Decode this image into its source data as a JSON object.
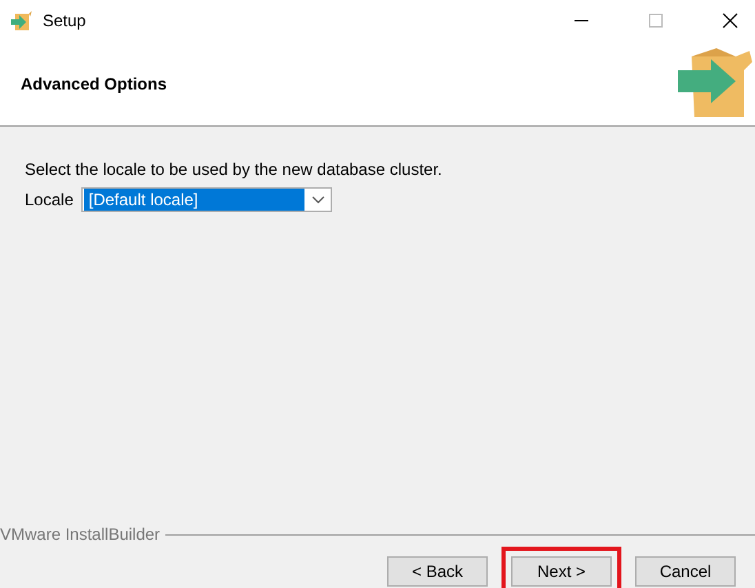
{
  "window": {
    "title": "Setup"
  },
  "header": {
    "title": "Advanced Options"
  },
  "body": {
    "instruction": "Select the locale to be used by the new database cluster.",
    "locale": {
      "label": "Locale",
      "value": "[Default locale]"
    }
  },
  "footer": {
    "brand": "VMware InstallBuilder"
  },
  "buttons": [
    {
      "label": "< Back",
      "highlighted": false
    },
    {
      "label": "Next >",
      "highlighted": true
    },
    {
      "label": "Cancel",
      "highlighted": false
    }
  ]
}
